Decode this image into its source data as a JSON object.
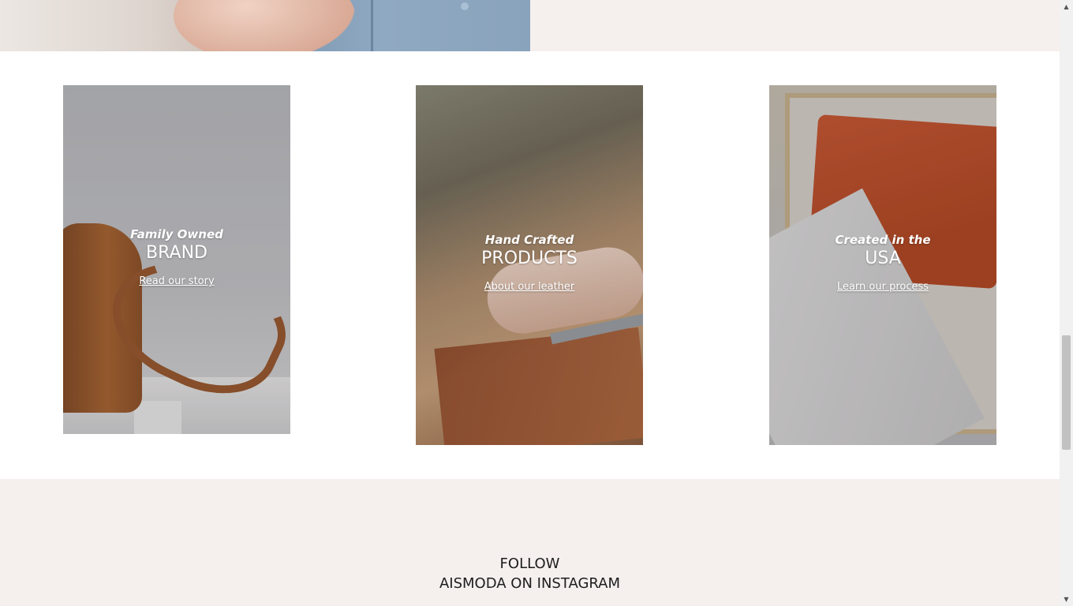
{
  "cards": [
    {
      "eyebrow": "Family Owned",
      "headline": "BRAND",
      "link": "Read our story"
    },
    {
      "eyebrow": "Hand Crafted",
      "headline": "PRODUCTS",
      "link": "About our leather"
    },
    {
      "eyebrow": "Created in the",
      "headline": "USA",
      "link": "Learn our process"
    }
  ],
  "follow": {
    "line1": "FOLLOW",
    "line2": "AISMODA ON INSTAGRAM"
  },
  "colors": {
    "page_bg": "#f5efee",
    "section_bg": "#ffffff",
    "text": "#1d1d1d"
  },
  "icons": {
    "scroll_up": "triangle-up",
    "scroll_down": "triangle-down"
  }
}
